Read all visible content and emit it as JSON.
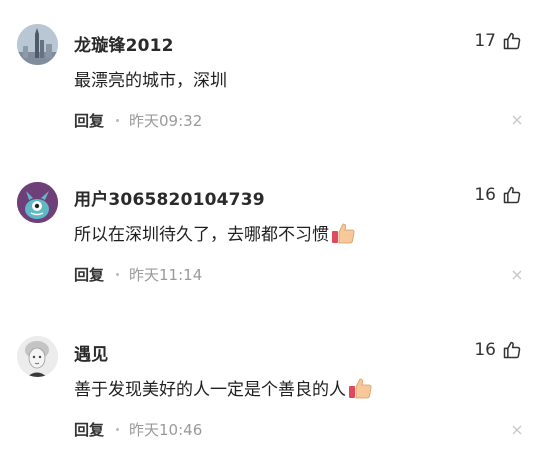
{
  "comments": [
    {
      "username": "龙璇锋2012",
      "likes": "17",
      "text": "最漂亮的城市，深圳",
      "has_emoji": false,
      "reply_label": "回复",
      "time": "昨天09:32",
      "avatar_icon": "city-tower-icon"
    },
    {
      "username": "用户3065820104739",
      "likes": "16",
      "text": "所以在深圳待久了，去哪都不习惯",
      "has_emoji": true,
      "reply_label": "回复",
      "time": "昨天11:14",
      "avatar_icon": "cartoon-monster-icon"
    },
    {
      "username": "遇见",
      "likes": "16",
      "text": "善于发现美好的人一定是个善良的人",
      "has_emoji": true,
      "reply_label": "回复",
      "time": "昨天10:46",
      "avatar_icon": "sketch-portrait-icon"
    }
  ],
  "colors": {
    "text": "#1f1f1f",
    "time": "#9a9a9a",
    "close": "#c8c8c8"
  }
}
